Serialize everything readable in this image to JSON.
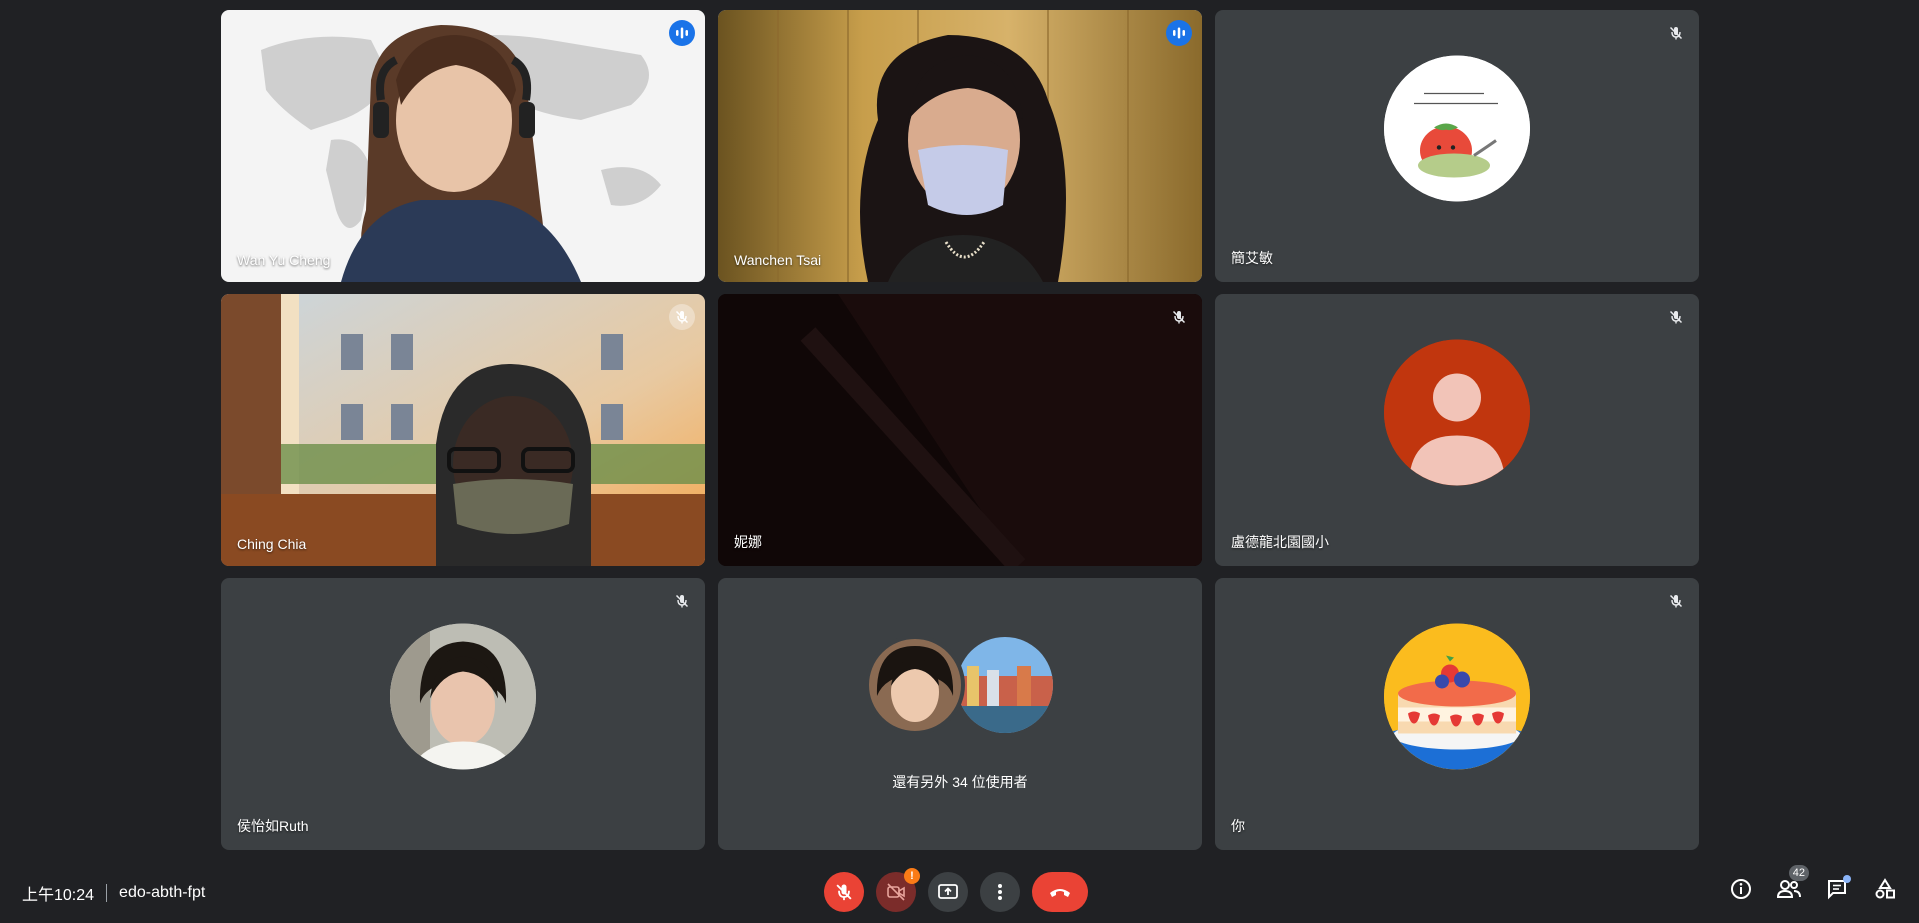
{
  "participants": [
    {
      "name": "Wan Yu Cheng",
      "state": "speaking"
    },
    {
      "name": "Wanchen Tsai",
      "state": "speaking"
    },
    {
      "name": "簡艾敏",
      "state": "muted"
    },
    {
      "name": "Ching Chia",
      "state": "muted"
    },
    {
      "name": "妮娜",
      "state": "muted"
    },
    {
      "name": "盧德龍北園國小",
      "state": "muted"
    },
    {
      "name": "侯怡如Ruth",
      "state": "muted"
    },
    {
      "name": "你",
      "state": "muted"
    }
  ],
  "others_text": "還有另外 34 位使用者",
  "meeting": {
    "time": "上午10:24",
    "code": "edo-abth-fpt"
  },
  "toolbar": {
    "camera_warning": "!"
  },
  "people_count": "42",
  "colors": {
    "background": "#202124",
    "tile": "#3c4043",
    "accent": "#1a73e8",
    "danger": "#ea4335",
    "warning": "#fa7b17"
  }
}
